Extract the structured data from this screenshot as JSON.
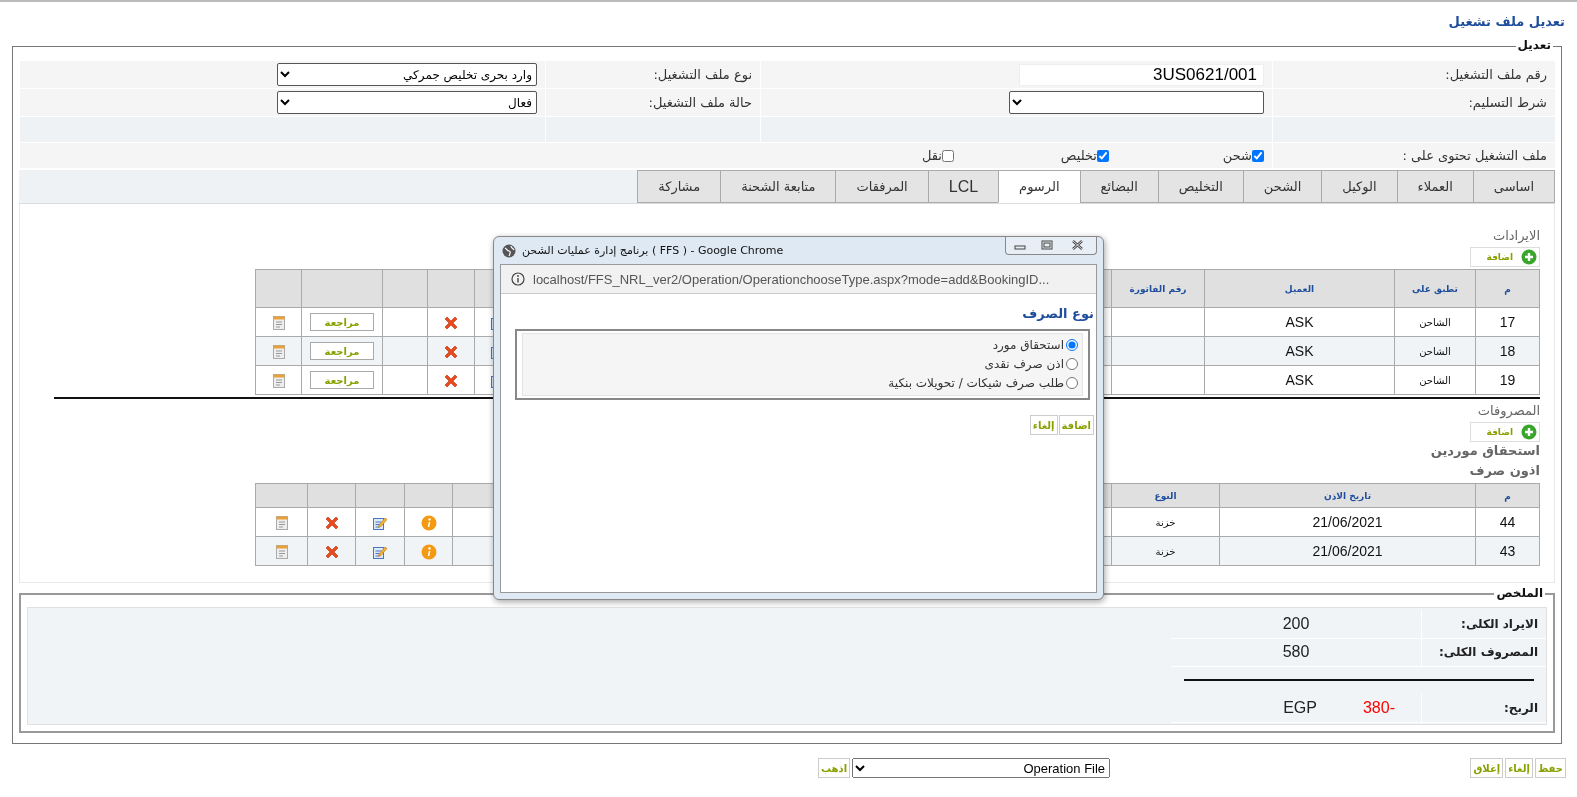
{
  "page_title": "تعديل ملف تشغيل",
  "edit_section": {
    "legend": "تعديل",
    "form_rows": [
      {
        "kind": "fields",
        "cells": [
          {
            "kind": "label",
            "text": "رقم ملف التشغيل:"
          },
          {
            "kind": "text_input",
            "value": "3US0621/001"
          },
          {
            "kind": "label",
            "text": "نوع ملف التشغيل:"
          },
          {
            "kind": "select",
            "value": "وارد بحرى تخليص جمركي"
          }
        ]
      },
      {
        "kind": "fields",
        "cells": [
          {
            "kind": "label",
            "text": "شرط التسليم:"
          },
          {
            "kind": "select"
          },
          {
            "kind": "label",
            "text": "حالة ملف التشغيل:"
          },
          {
            "kind": "select",
            "value": "فعال"
          }
        ]
      },
      {
        "kind": "blank"
      },
      {
        "kind": "checks",
        "label": "ملف التشغيل تحتوى على :",
        "items": [
          {
            "label": "شحن",
            "checked": true
          },
          {
            "label": "تخليص",
            "checked": true
          },
          {
            "label": "نقل",
            "checked": false
          }
        ]
      }
    ]
  },
  "tabs": [
    {
      "label": "اساسى",
      "selected": false
    },
    {
      "label": "العملاء",
      "selected": false
    },
    {
      "label": "الوكيل",
      "selected": false
    },
    {
      "label": "الشحن",
      "selected": false
    },
    {
      "label": "التخليص",
      "selected": false
    },
    {
      "label": "البضائع",
      "selected": false
    },
    {
      "label": "الرسوم",
      "selected": true
    },
    {
      "label": "LCL",
      "selected": false
    },
    {
      "label": "المرفقات",
      "selected": false
    },
    {
      "label": "متابعة الشحنة",
      "selected": false
    },
    {
      "label": "مشاركة",
      "selected": false
    }
  ],
  "revenues": {
    "title": "الايرادات",
    "add_button": "اضافة",
    "columns": [
      "م",
      "تطبق على",
      "العميل",
      "رقم الفاتورة"
    ],
    "rows": [
      {
        "cells": [
          "17",
          "الشاحن",
          "ASK",
          ""
        ],
        "review_button": "مراجعة"
      },
      {
        "cells": [
          "18",
          "الشاحن",
          "ASK",
          ""
        ],
        "review_button": "مراجعة"
      },
      {
        "cells": [
          "19",
          "الشاحن",
          "ASK",
          ""
        ],
        "review_button": "مراجعة"
      }
    ]
  },
  "expenses": {
    "title": "المصروفات",
    "add_button": "اضافة",
    "subtitles": [
      "استحقاق موردين",
      "اذون صرف"
    ],
    "columns": [
      "م",
      "تاريخ الاذن",
      "النوع"
    ],
    "rows": [
      {
        "cells": [
          "44",
          "21/06/2021",
          "خزنة"
        ]
      },
      {
        "cells": [
          "43",
          "21/06/2021",
          "خزنة"
        ]
      }
    ]
  },
  "summary": {
    "legend": "الملخص",
    "rows": [
      {
        "kind": "total",
        "label": "الايراد الكلى:",
        "value": "200"
      },
      {
        "kind": "total",
        "label": "المصروف الكلى:",
        "value": "580"
      },
      {
        "kind": "rule"
      },
      {
        "kind": "profit",
        "label": "الربح:",
        "value": "-380",
        "currency": "EGP"
      }
    ]
  },
  "footer": {
    "buttons": [
      "حفظ",
      "إلغاء",
      "إغلاق"
    ],
    "page_select": "Operation File",
    "go_button": "اذهب"
  },
  "popup": {
    "title": "برنامج إدارة عمليات الشحن ( FFS ) - Google Chrome",
    "url": "localhost/FFS_NRL_ver2/Operation/OperationchooseType.aspx?mode=add&BookingID...",
    "heading": "نوع الصرف",
    "options": [
      {
        "label": "استحقاق مورد",
        "selected": true
      },
      {
        "label": "اذن صرف نقدى",
        "selected": false
      },
      {
        "label": "طلب صرف شيكات / تحويلات بنكية",
        "selected": false
      }
    ],
    "buttons": [
      "اضافة",
      "إلغاء"
    ]
  }
}
